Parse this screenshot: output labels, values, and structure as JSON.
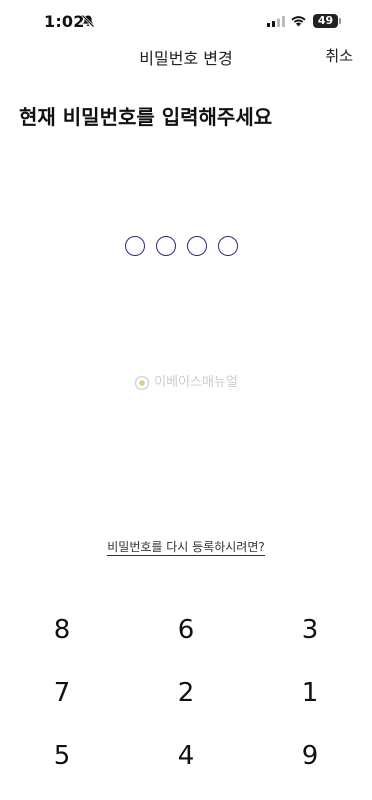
{
  "status_bar": {
    "time": "1:02",
    "battery": "49"
  },
  "nav": {
    "title": "비밀번호 변경",
    "cancel_label": "취소"
  },
  "heading": "현재 비밀번호를 입력해주세요",
  "pin": {
    "length": 4,
    "filled": 0
  },
  "watermark": "이베이스매뉴얼",
  "forgot_link": "비밀번호를 다시 등록하시려면?",
  "keypad": {
    "keys": [
      "8",
      "6",
      "3",
      "7",
      "2",
      "1",
      "5",
      "4",
      "9"
    ]
  },
  "colors": {
    "pin_outline": "#2a2a7a",
    "watermark": "#c8ccd6"
  }
}
